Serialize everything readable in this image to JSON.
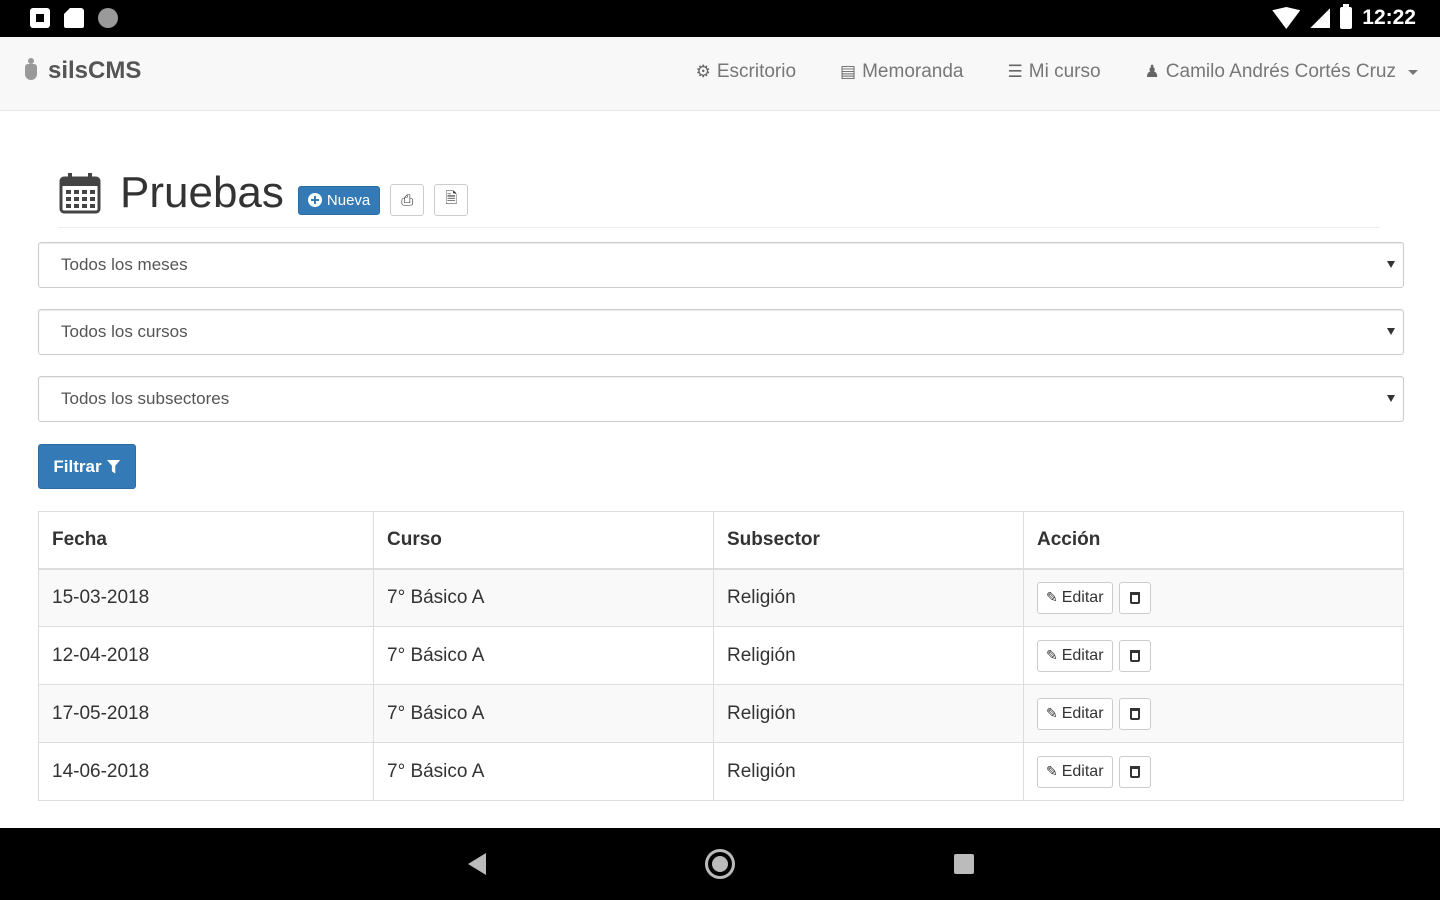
{
  "status_bar": {
    "time": "12:22",
    "icons": [
      "notification-icon",
      "sd-card-icon",
      "circle-icon",
      "wifi-icon",
      "signal-icon",
      "battery-icon"
    ]
  },
  "navbar": {
    "brand": "silsCMS",
    "items": [
      {
        "label": "Escritorio",
        "icon": "dashboard-icon"
      },
      {
        "label": "Memoranda",
        "icon": "memo-icon"
      },
      {
        "label": "Mi curso",
        "icon": "list-icon"
      },
      {
        "label": "Camilo Andrés Cortés Cruz",
        "icon": "user-icon"
      }
    ]
  },
  "page": {
    "title": "Pruebas",
    "new_button": "Nueva",
    "print_icon": "print-icon",
    "pdf_icon": "pdf-icon"
  },
  "filters": {
    "months": "Todos los meses",
    "courses": "Todos los cursos",
    "subsectors": "Todos los subsectores",
    "filter_button": "Filtrar"
  },
  "table": {
    "headers": [
      "Fecha",
      "Curso",
      "Subsector",
      "Acción"
    ],
    "edit_label": "Editar",
    "rows": [
      {
        "fecha": "15-03-2018",
        "curso": "7° Básico A",
        "subsector": "Religión"
      },
      {
        "fecha": "12-04-2018",
        "curso": "7° Básico A",
        "subsector": "Religión"
      },
      {
        "fecha": "17-05-2018",
        "curso": "7° Básico A",
        "subsector": "Religión"
      },
      {
        "fecha": "14-06-2018",
        "curso": "7° Básico A",
        "subsector": "Religión"
      }
    ]
  },
  "colors": {
    "primary": "#337ab7",
    "navbar_bg": "#f8f8f8",
    "stripe": "#f9f9f9"
  }
}
